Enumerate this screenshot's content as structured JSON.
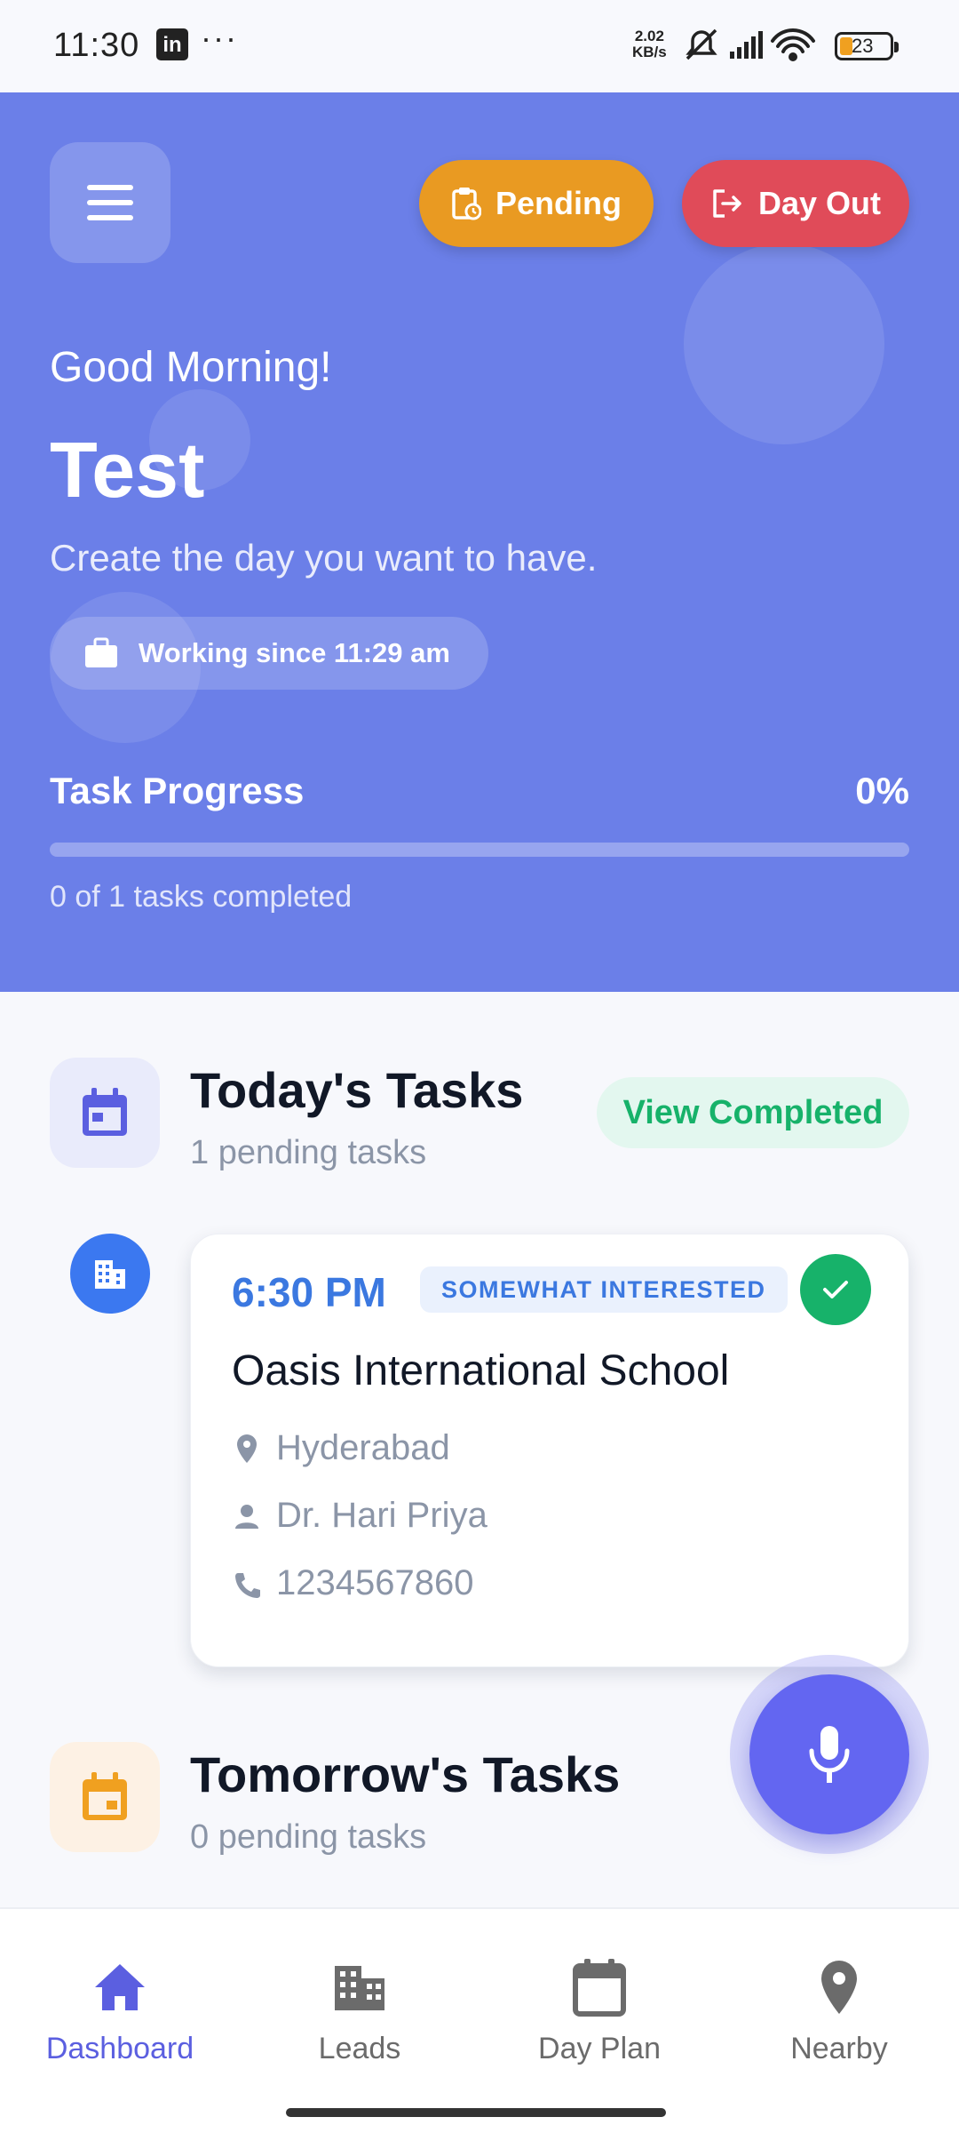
{
  "status_bar": {
    "time": "11:30",
    "speed_value": "2.02",
    "speed_unit": "KB/s",
    "battery": "23",
    "more": "···",
    "notification_icon": "linkedin-icon"
  },
  "header": {
    "pending_label": "Pending",
    "day_out_label": "Day Out",
    "greeting": "Good Morning!",
    "user_name": "Test",
    "tagline": "Create the day you want to have.",
    "working_since": "Working since 11:29 am",
    "progress_title": "Task Progress",
    "progress_percent": "0%",
    "progress_value": 0,
    "progress_summary": "0 of 1 tasks completed"
  },
  "today": {
    "title": "Today's Tasks",
    "subtitle": "1 pending tasks",
    "view_completed": "View Completed"
  },
  "task": {
    "time": "6:30 PM",
    "status": "SOMEWHAT INTERESTED",
    "name": "Oasis International School",
    "location": "Hyderabad",
    "contact": "Dr. Hari Priya",
    "phone": "1234567860"
  },
  "tomorrow": {
    "title": "Tomorrow's Tasks",
    "subtitle": "0 pending tasks"
  },
  "nav": {
    "items": [
      {
        "label": "Dashboard",
        "icon": "home-icon",
        "active": true
      },
      {
        "label": "Leads",
        "icon": "building-icon",
        "active": false
      },
      {
        "label": "Day Plan",
        "icon": "calendar-icon",
        "active": false
      },
      {
        "label": "Nearby",
        "icon": "location-pin-icon",
        "active": false
      }
    ]
  },
  "colors": {
    "hero": "#6b7fe8",
    "pending": "#e99a22",
    "day_out": "#e04b59",
    "accent": "#5b5fe0",
    "success": "#17b26a"
  }
}
